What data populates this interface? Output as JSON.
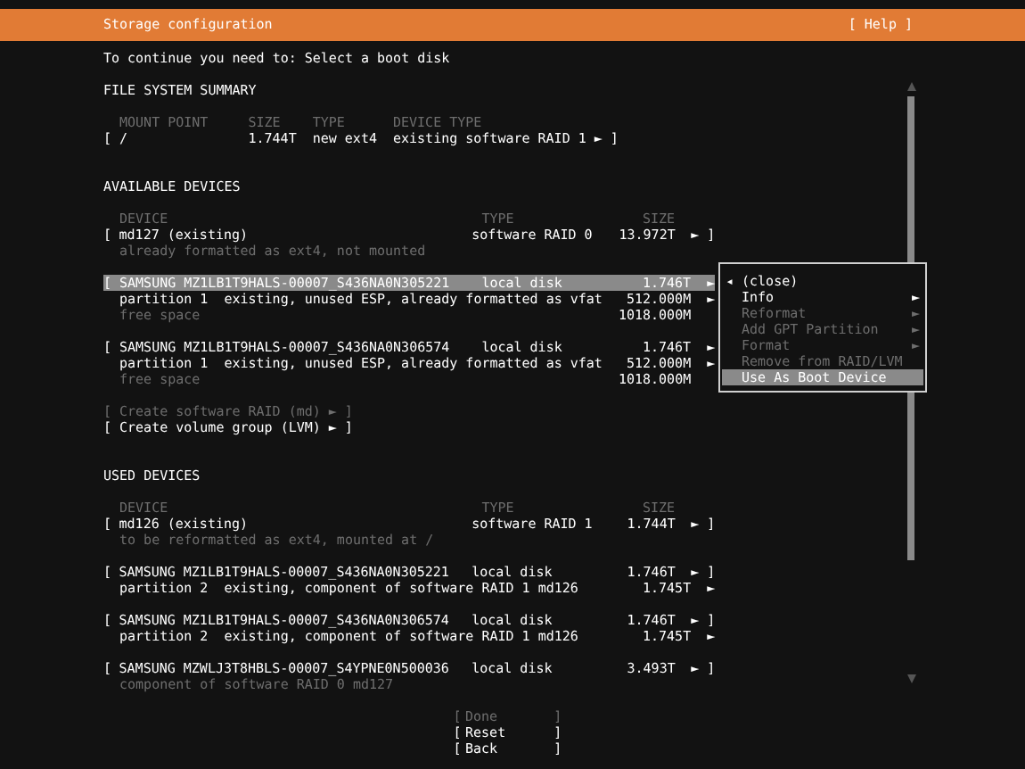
{
  "header": {
    "title": "Storage configuration",
    "help": "[ Help ]"
  },
  "instruction": "To continue you need to: Select a boot disk",
  "file_system_summary": {
    "heading": "FILE SYSTEM SUMMARY",
    "columns": [
      "MOUNT POINT",
      "SIZE",
      "TYPE",
      "DEVICE TYPE"
    ],
    "rows": [
      {
        "bracket_open": "[",
        "mount_point": "/",
        "size": "1.744T",
        "type": "new ext4",
        "device_type": "existing software RAID 1",
        "arrow": "►",
        "bracket_close": "]"
      }
    ]
  },
  "available_devices": {
    "heading": "AVAILABLE DEVICES",
    "columns": [
      "DEVICE",
      "TYPE",
      "SIZE"
    ],
    "devices": [
      {
        "bracket_open": "[",
        "name": "md127 (existing)",
        "type": "software RAID 0",
        "size": "13.972T",
        "arrow": "►",
        "bracket_close": "]",
        "selected": false,
        "lines": [
          {
            "kind": "note",
            "text": "already formatted as ext4, not mounted"
          }
        ]
      },
      {
        "bracket_open": "[",
        "name": "SAMSUNG MZ1LB1T9HALS-00007_S436NA0N305221",
        "type": "local disk",
        "size": "1.746T",
        "arrow": "►",
        "selected": true,
        "lines": [
          {
            "kind": "partition",
            "label": "partition 1  existing, unused ESP, already formatted as vfat",
            "size": "512.000M",
            "arrow": "►"
          },
          {
            "kind": "free",
            "label": "free space",
            "size": "1018.000M"
          }
        ]
      },
      {
        "bracket_open": "[",
        "name": "SAMSUNG MZ1LB1T9HALS-00007_S436NA0N306574",
        "type": "local disk",
        "size": "1.746T",
        "arrow": "►",
        "selected": false,
        "lines": [
          {
            "kind": "partition",
            "label": "partition 1  existing, unused ESP, already formatted as vfat",
            "size": "512.000M",
            "arrow": "►"
          },
          {
            "kind": "free",
            "label": "free space",
            "size": "1018.000M"
          }
        ]
      }
    ],
    "actions": [
      {
        "bracket_open": "[",
        "label": "Create software RAID (md)",
        "arrow": "►",
        "bracket_close": "]",
        "disabled": true
      },
      {
        "bracket_open": "[",
        "label": "Create volume group (LVM)",
        "arrow": "►",
        "bracket_close": "]",
        "disabled": false
      }
    ]
  },
  "used_devices": {
    "heading": "USED DEVICES",
    "columns": [
      "DEVICE",
      "TYPE",
      "SIZE"
    ],
    "devices": [
      {
        "bracket_open": "[",
        "name": "md126 (existing)",
        "type": "software RAID 1",
        "size": "1.744T",
        "arrow": "►",
        "bracket_close": "]",
        "selected": false,
        "lines": [
          {
            "kind": "note",
            "text": "to be reformatted as ext4, mounted at /"
          }
        ]
      },
      {
        "bracket_open": "[",
        "name": "SAMSUNG MZ1LB1T9HALS-00007_S436NA0N305221",
        "type": "local disk",
        "size": "1.746T",
        "arrow": "►",
        "bracket_close": "]",
        "selected": false,
        "lines": [
          {
            "kind": "partition",
            "label": "partition 2  existing, component of software RAID 1 md126",
            "size": "1.745T",
            "arrow": "►"
          }
        ]
      },
      {
        "bracket_open": "[",
        "name": "SAMSUNG MZ1LB1T9HALS-00007_S436NA0N306574",
        "type": "local disk",
        "size": "1.746T",
        "arrow": "►",
        "bracket_close": "]",
        "selected": false,
        "lines": [
          {
            "kind": "partition",
            "label": "partition 2  existing, component of software RAID 1 md126",
            "size": "1.745T",
            "arrow": "►"
          }
        ]
      },
      {
        "bracket_open": "[",
        "name": "SAMSUNG MZWLJ3T8HBLS-00007_S4YPNE0N500036",
        "type": "local disk",
        "size": "3.493T",
        "arrow": "►",
        "bracket_close": "]",
        "selected": false,
        "lines": [
          {
            "kind": "note",
            "text": "component of software RAID 0 md127"
          }
        ]
      }
    ]
  },
  "buttons": [
    {
      "bracket_open": "[",
      "label": "Done",
      "bracket_close": "]",
      "disabled": true
    },
    {
      "bracket_open": "[",
      "label": "Reset",
      "bracket_close": "]",
      "disabled": false
    },
    {
      "bracket_open": "[",
      "label": "Back",
      "bracket_close": "]",
      "disabled": false
    }
  ],
  "menu": {
    "items": [
      {
        "prefix": "◂",
        "label": "(close)",
        "disabled": false,
        "selected": false
      },
      {
        "label": "Info",
        "arrow": "►",
        "disabled": false,
        "selected": false
      },
      {
        "label": "Reformat",
        "arrow": "►",
        "disabled": true,
        "selected": false
      },
      {
        "label": "Add GPT Partition",
        "arrow": "►",
        "disabled": true,
        "selected": false
      },
      {
        "label": "Format",
        "arrow": "►",
        "disabled": true,
        "selected": false
      },
      {
        "label": "Remove from RAID/LVM",
        "disabled": true,
        "selected": false
      },
      {
        "label": "Use As Boot Device",
        "disabled": false,
        "selected": true
      }
    ]
  }
}
